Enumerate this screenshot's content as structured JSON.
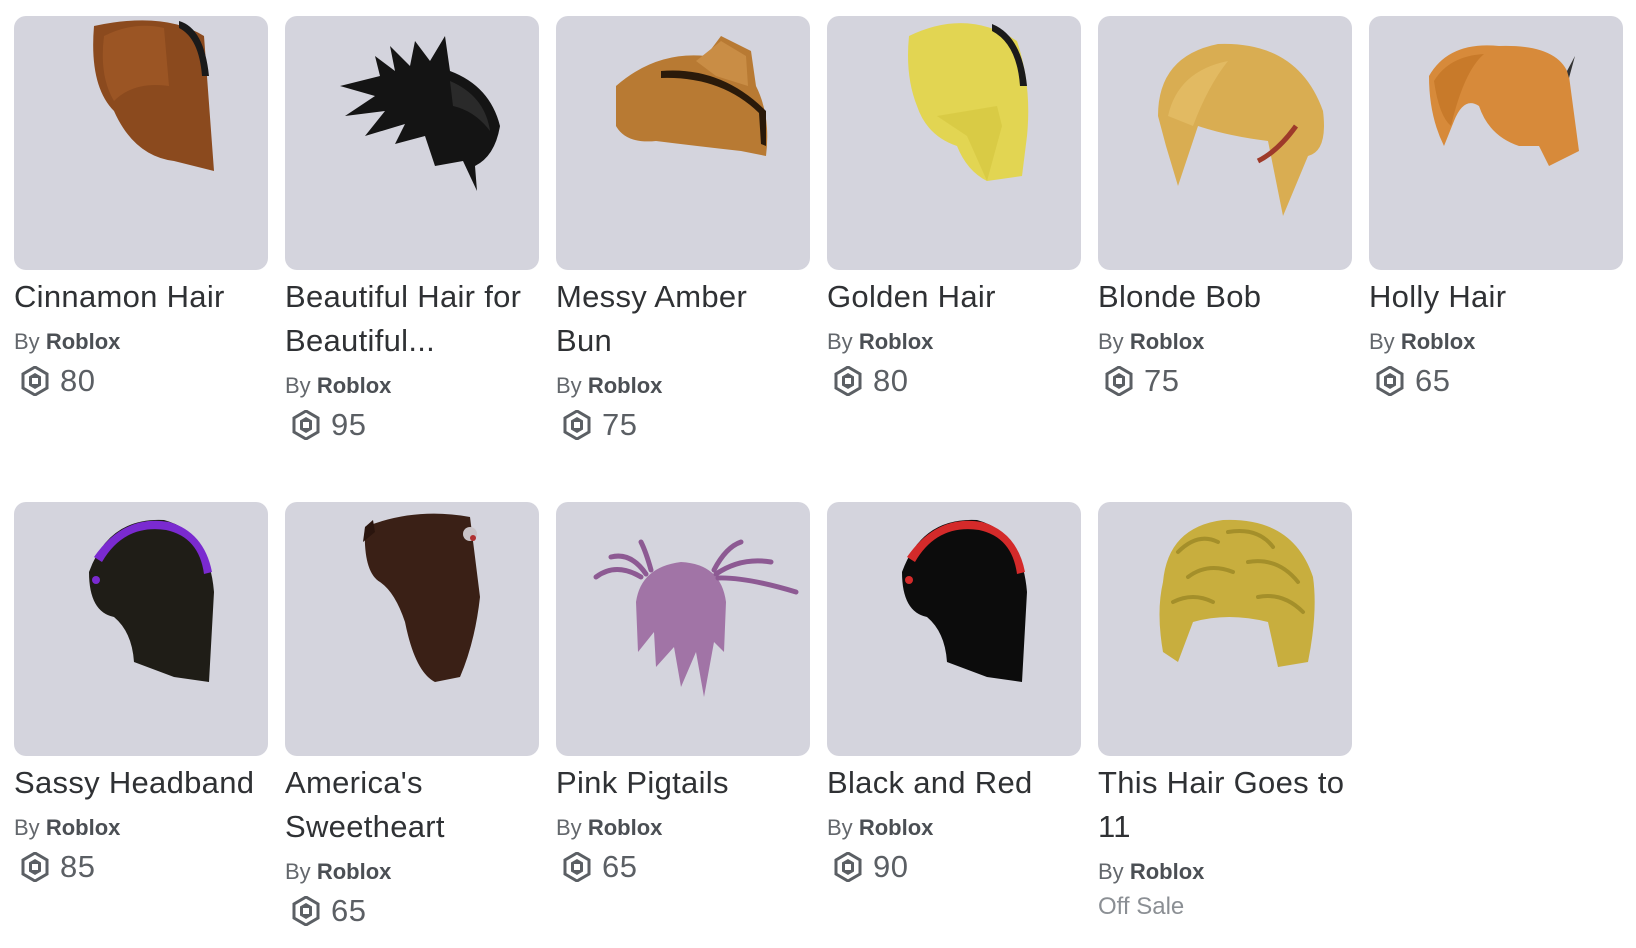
{
  "items": [
    {
      "name": "Cinnamon Hair",
      "by": "By",
      "creator": "Roblox",
      "price": "80",
      "currency_icon": "robux-icon",
      "colors": {
        "main": "#8a4a1e",
        "band": "#1a1a1a"
      }
    },
    {
      "name": "Beautiful Hair for Beautiful...",
      "by": "By",
      "creator": "Roblox",
      "price": "95",
      "currency_icon": "robux-icon",
      "colors": {
        "main": "#141414"
      }
    },
    {
      "name": "Messy Amber Bun",
      "by": "By",
      "creator": "Roblox",
      "price": "75",
      "currency_icon": "robux-icon",
      "colors": {
        "main": "#b87a33",
        "band": "#2a1a0a"
      }
    },
    {
      "name": "Golden Hair",
      "by": "By",
      "creator": "Roblox",
      "price": "80",
      "currency_icon": "robux-icon",
      "colors": {
        "main": "#e2d552",
        "band": "#1a1a1a"
      }
    },
    {
      "name": "Blonde Bob",
      "by": "By",
      "creator": "Roblox",
      "price": "75",
      "currency_icon": "robux-icon",
      "colors": {
        "main": "#d9ad52",
        "band": "#9e3a2a"
      }
    },
    {
      "name": "Holly Hair",
      "by": "By",
      "creator": "Roblox",
      "price": "65",
      "currency_icon": "robux-icon",
      "colors": {
        "main": "#d78a3a"
      }
    },
    {
      "name": "Sassy Headband",
      "by": "By",
      "creator": "Roblox",
      "price": "85",
      "currency_icon": "robux-icon",
      "colors": {
        "main": "#1f1d17",
        "band": "#7a2ad0"
      }
    },
    {
      "name": "America's Sweetheart",
      "by": "By",
      "creator": "Roblox",
      "price": "65",
      "currency_icon": "robux-icon",
      "colors": {
        "main": "#3a2016"
      }
    },
    {
      "name": "Pink Pigtails",
      "by": "By",
      "creator": "Roblox",
      "price": "65",
      "currency_icon": "robux-icon",
      "colors": {
        "main": "#a174a6"
      }
    },
    {
      "name": "Black and Red",
      "by": "By",
      "creator": "Roblox",
      "price": "90",
      "currency_icon": "robux-icon",
      "colors": {
        "main": "#0c0c0c",
        "band": "#d42a2a"
      }
    },
    {
      "name": "This Hair Goes to 11",
      "by": "By",
      "creator": "Roblox",
      "price": "",
      "status": "Off Sale",
      "colors": {
        "main": "#c8ae3e"
      }
    }
  ]
}
